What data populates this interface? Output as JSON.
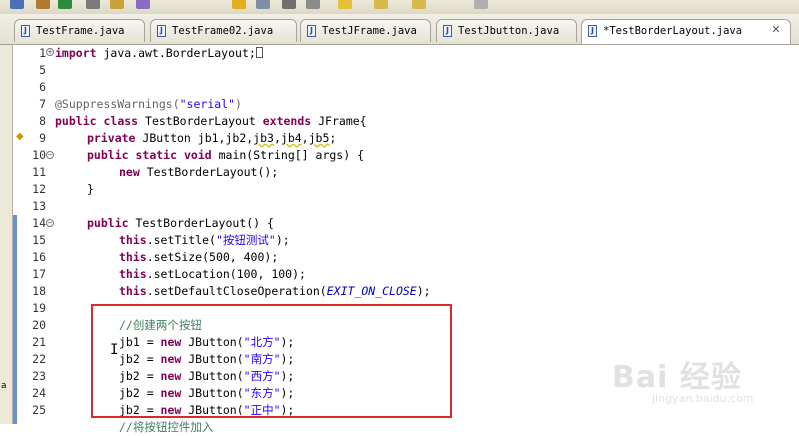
{
  "toolbar": {
    "icons": [
      {
        "name": "save-icon",
        "color": "#4a6fb5"
      },
      {
        "name": "build-icon",
        "color": "#b07a2a"
      },
      {
        "name": "run-icon",
        "color": "#2e8b3a"
      },
      {
        "name": "debug-icon",
        "color": "#7a7a7a"
      },
      {
        "name": "folder-icon",
        "color": "#c9a23a"
      },
      {
        "name": "task-icon",
        "color": "#8a6cc2"
      },
      {
        "name": "highlight-icon",
        "color": "#e0b020"
      },
      {
        "name": "pin-icon",
        "color": "#7f8fa8"
      },
      {
        "name": "format-icon",
        "color": "#6e6e6e"
      },
      {
        "name": "search-icon",
        "color": "#8a8a8a"
      },
      {
        "name": "lightbulb-icon",
        "color": "#e3c23a"
      },
      {
        "name": "forward-arrow-icon",
        "color": "#d8b84a"
      },
      {
        "name": "back-arrow-icon",
        "color": "#d8b84a"
      },
      {
        "name": "next-arrow-icon",
        "color": "#b0b0b0"
      }
    ]
  },
  "tabs": [
    {
      "label": "TestFrame.java",
      "icon": "J"
    },
    {
      "label": "TestFrame02.java",
      "icon": "J"
    },
    {
      "label": "TestJFrame.java",
      "icon": "J"
    },
    {
      "label": "TestJbutton.java",
      "icon": "J"
    },
    {
      "label": "*TestBorderLayout.java",
      "icon": "J",
      "active": true,
      "close": "✕"
    }
  ],
  "left_strip_fragment": "a",
  "editor": {
    "line_numbers": [
      "1",
      "5",
      "6",
      "7",
      "8",
      "9",
      "10",
      "11",
      "12",
      "13",
      "14",
      "15",
      "16",
      "17",
      "18",
      "19",
      "20",
      "21",
      "22",
      "23",
      "24",
      "25"
    ],
    "lines": {
      "l1": {
        "kw": "import",
        "rest": " java.awt.BorderLayout;"
      },
      "l7": {
        "ann": "@SuppressWarnings(",
        "str": "\"serial\"",
        "end": ")"
      },
      "l8": {
        "kw1": "public",
        "kw2": "class",
        "mid": " TestBorderLayout ",
        "kw3": "extends",
        "end": " JFrame{"
      },
      "l9": {
        "kw": "private",
        "p1": " JButton jb1,jb2,",
        "u1": "jb3",
        "c1": ",",
        "u2": "jb4",
        "c2": ",",
        "u3": "jb5",
        "end": ";"
      },
      "l10": {
        "kw1": "public",
        "kw2": "static",
        "kw3": "void",
        "end": " main(String[] args) {"
      },
      "l11": {
        "kw": "new",
        "end": " TestBorderLayout();"
      },
      "l12": {
        "end": "}"
      },
      "l14": {
        "kw": "public",
        "end": " TestBorderLayout() {"
      },
      "l15": {
        "kw": "this",
        "mid": ".setTitle(",
        "str": "\"按钮测试\"",
        "end": ");"
      },
      "l16": {
        "kw": "this",
        "end": ".setSize(500, 400);"
      },
      "l17": {
        "kw": "this",
        "end": ".setLocation(100, 100);"
      },
      "l18": {
        "kw": "this",
        "mid": ".setDefaultCloseOperation(",
        "const": "EXIT_ON_CLOSE",
        "end": ");"
      },
      "l20": {
        "cmt": "//创建两个按钮"
      },
      "l21": {
        "pre": "jb1 = ",
        "kw": "new",
        "mid": " JButton(",
        "str": "\"北方\"",
        "end": ");"
      },
      "l22": {
        "pre": "jb2 = ",
        "kw": "new",
        "mid": " JButton(",
        "str": "\"南方\"",
        "end": ");"
      },
      "l23": {
        "pre": "jb2 = ",
        "kw": "new",
        "mid": " JButton(",
        "str": "\"西方\"",
        "end": ");"
      },
      "l24": {
        "pre": "jb2 = ",
        "kw": "new",
        "mid": " JButton(",
        "str": "\"东方\"",
        "end": ");"
      },
      "l25": {
        "pre": "jb2 = ",
        "kw": "new",
        "mid": " JButton(",
        "str": "\"正中\"",
        "end": ");"
      },
      "l26": {
        "cmt": "//将按钮控件加入"
      }
    }
  },
  "watermark": {
    "brand": "Bai 经验",
    "url": "jingyan.baidu.com"
  },
  "colors": {
    "keyword": "#7f0055",
    "string": "#2a00ff",
    "comment": "#3f7f5f",
    "highlight_box": "#d9292b"
  }
}
